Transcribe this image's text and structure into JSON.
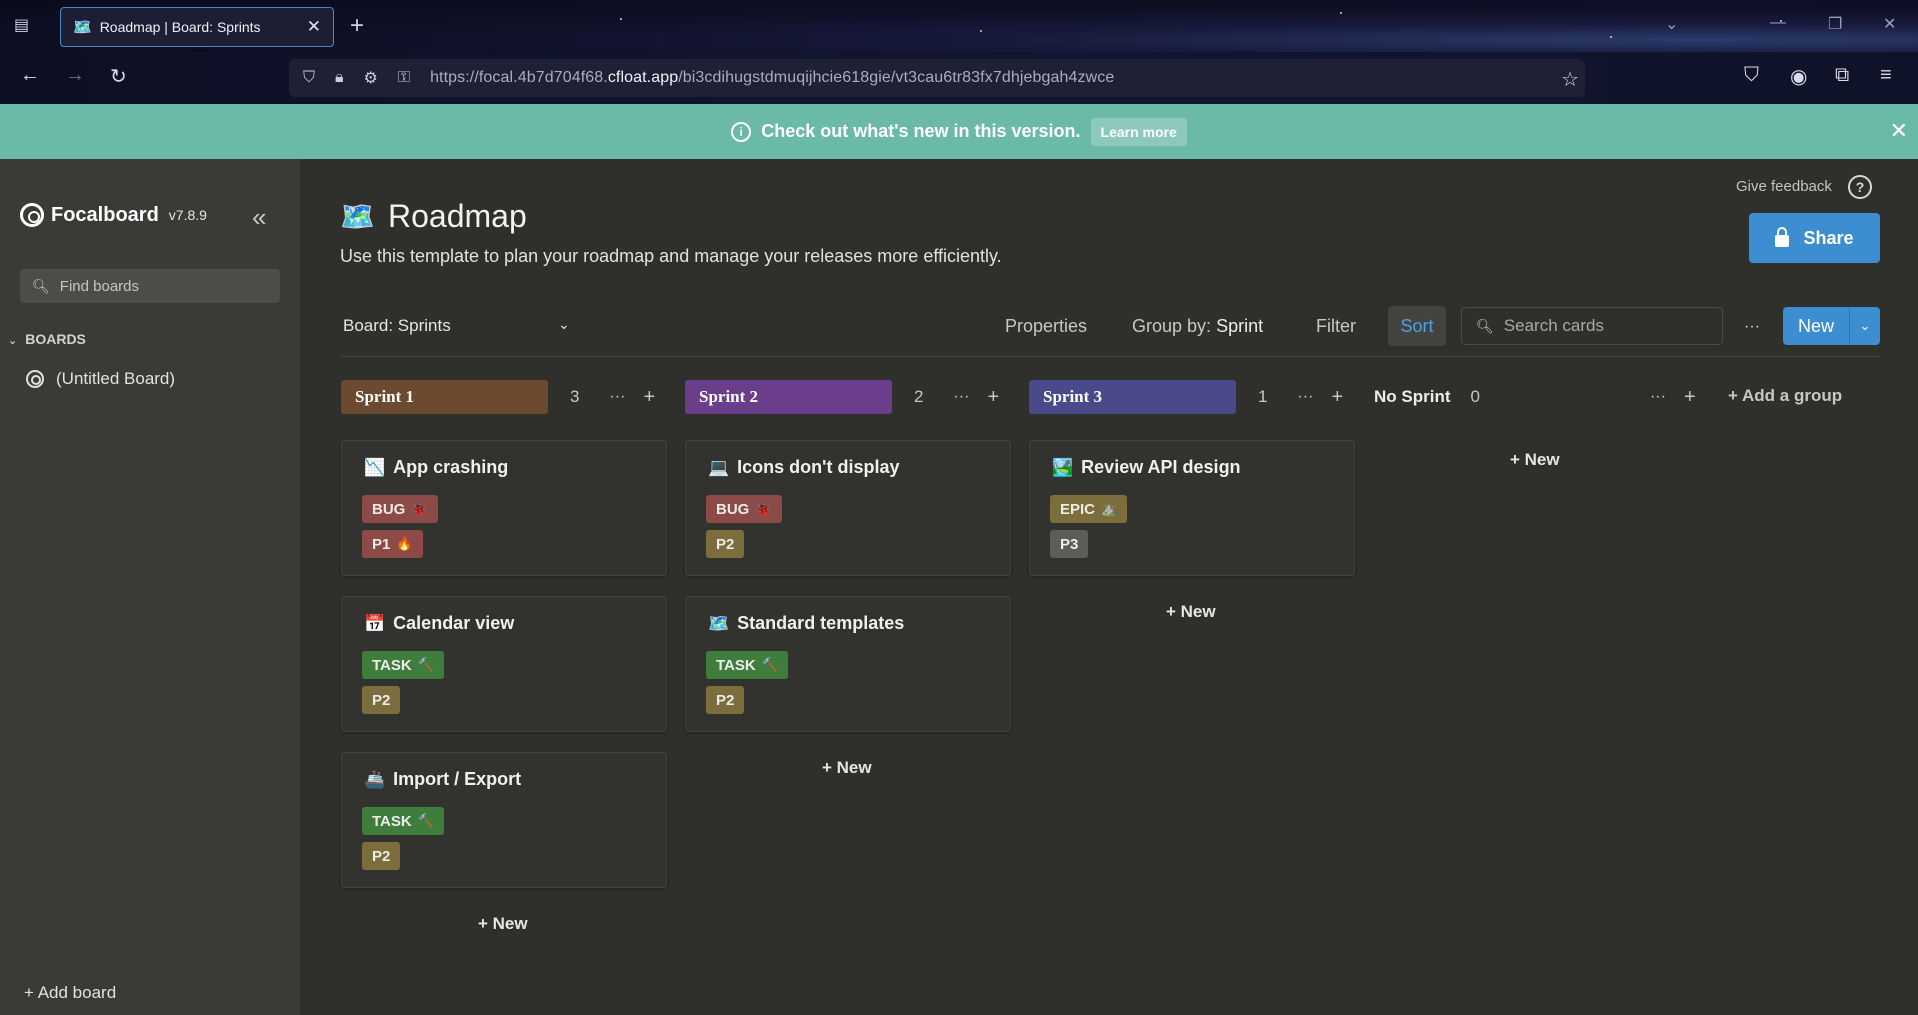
{
  "browser": {
    "tab_title": "Roadmap | Board: Sprints",
    "url_prefix": "https://focal.4b7d704f68.",
    "url_domain": "cfloat.app",
    "url_suffix": "/bi3cdihugstdmuqijhcie618gie/vt3cau6tr83fx7dhjebgah4zwce"
  },
  "banner": {
    "message": "Check out what's new in this version.",
    "learn_more": "Learn more"
  },
  "sidebar": {
    "app_name": "Focalboard",
    "version": "v7.8.9",
    "find_placeholder": "Find boards",
    "boards_header": "BOARDS",
    "boards": [
      {
        "label": "(Untitled Board)"
      }
    ],
    "add_board": "+ Add board"
  },
  "header": {
    "feedback": "Give feedback",
    "help": "?",
    "share": "Share",
    "title_icon": "🗺️",
    "title": "Roadmap",
    "description": "Use this template to plan your roadmap and manage your releases more efficiently."
  },
  "toolbar": {
    "view": "Board: Sprints",
    "properties": "Properties",
    "group_by_label": "Group by:",
    "group_by_value": "Sprint",
    "filter": "Filter",
    "sort": "Sort",
    "search_placeholder": "Search cards",
    "more": "···",
    "new": "New"
  },
  "board": {
    "add_group": "+ Add a group",
    "columns": [
      {
        "name": "Sprint 1",
        "count": "3",
        "color": "#6b4a2f",
        "new_label": "+ New",
        "cards": [
          {
            "icon": "📉",
            "title": "App crashing",
            "tags": [
              {
                "text": "BUG",
                "icon": "🐞",
                "color": "#8c4b47"
              },
              {
                "text": "P1",
                "icon": "🔥",
                "color": "#8c4b47"
              }
            ]
          },
          {
            "icon": "📅",
            "title": "Calendar view",
            "tags": [
              {
                "text": "TASK",
                "icon": "🔨",
                "color": "#3e7d3c"
              },
              {
                "text": "P2",
                "icon": "",
                "color": "#7b6e3c"
              }
            ]
          },
          {
            "icon": "🚢",
            "title": "Import / Export",
            "tags": [
              {
                "text": "TASK",
                "icon": "🔨",
                "color": "#3e7d3c"
              },
              {
                "text": "P2",
                "icon": "",
                "color": "#7b6e3c"
              }
            ]
          }
        ]
      },
      {
        "name": "Sprint 2",
        "count": "2",
        "color": "#6a3e8a",
        "new_label": "+ New",
        "cards": [
          {
            "icon": "💻",
            "title": "Icons don't display",
            "tags": [
              {
                "text": "BUG",
                "icon": "🐞",
                "color": "#8c4b47"
              },
              {
                "text": "P2",
                "icon": "",
                "color": "#7b6e3c"
              }
            ]
          },
          {
            "icon": "🗺️",
            "title": "Standard templates",
            "tags": [
              {
                "text": "TASK",
                "icon": "🔨",
                "color": "#3e7d3c"
              },
              {
                "text": "P2",
                "icon": "",
                "color": "#7b6e3c"
              }
            ]
          }
        ]
      },
      {
        "name": "Sprint 3",
        "count": "1",
        "color": "#4a4a8a",
        "new_label": "+ New",
        "cards": [
          {
            "icon": "🏞️",
            "title": "Review API design",
            "tags": [
              {
                "text": "EPIC",
                "icon": "⛰️",
                "color": "#7b6e3c"
              },
              {
                "text": "P3",
                "icon": "",
                "color": "#5c5c58"
              }
            ]
          }
        ]
      },
      {
        "name": "No Sprint",
        "count": "0",
        "color": "",
        "new_label": "+ New",
        "cards": []
      }
    ]
  }
}
